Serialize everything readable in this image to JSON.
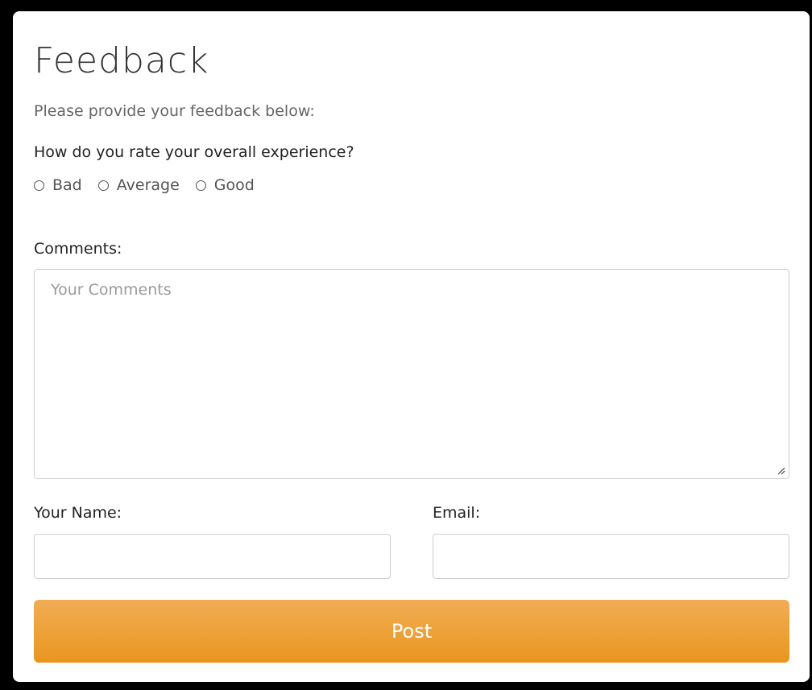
{
  "form": {
    "title": "Feedback",
    "subtitle": "Please provide your feedback below:",
    "question": "How do you rate your overall experience?",
    "rating_options": [
      "Bad",
      "Average",
      "Good"
    ],
    "comments_label": "Comments:",
    "comments_placeholder": "Your Comments",
    "name_label": "Your Name:",
    "name_value": "",
    "email_label": "Email:",
    "email_value": "",
    "submit_label": "Post"
  },
  "colors": {
    "accent": "#eda03a",
    "background": "#000000",
    "card": "#ffffff"
  },
  "icons": {
    "radio": "radio-unchecked-icon",
    "resize": "resize-handle-icon"
  }
}
